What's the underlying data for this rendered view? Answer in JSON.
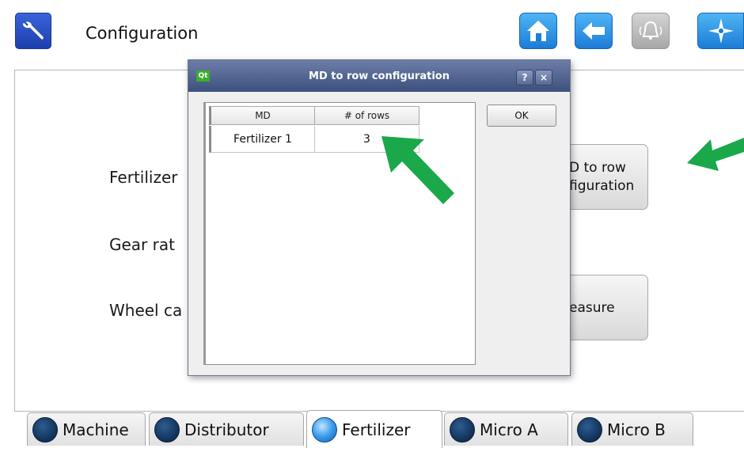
{
  "header": {
    "title": "Configuration",
    "icons": {
      "app": "wrench-icon",
      "home": "home-icon",
      "back": "back-arrow-icon",
      "alarm": "alarm-bell-icon",
      "nav": "compass-icon"
    }
  },
  "form": {
    "fertilizer_label": "Fertilizer",
    "gear_ratio_label": "Gear rat",
    "wheel_label": "Wheel ca",
    "md_to_row_button": "D to row\nfiguration",
    "measure_button": "easure"
  },
  "dialog": {
    "icon_text": "Qt",
    "title": "MD to row configuration",
    "help_glyph": "?",
    "close_glyph": "×",
    "ok_label": "OK",
    "table": {
      "columns": [
        "MD",
        "# of rows"
      ],
      "rows": [
        [
          "Fertilizer  1",
          "3"
        ]
      ]
    }
  },
  "tabs": [
    {
      "label": "Machine",
      "active": false
    },
    {
      "label": "Distributor",
      "active": false
    },
    {
      "label": "Fertilizer",
      "active": true
    },
    {
      "label": "Micro A",
      "active": false
    },
    {
      "label": "Micro B",
      "active": false
    }
  ],
  "colors": {
    "accent_blue": "#1c7cd6",
    "dialog_title": "#4a5c88",
    "annotation_arrow": "#1aa84a"
  }
}
